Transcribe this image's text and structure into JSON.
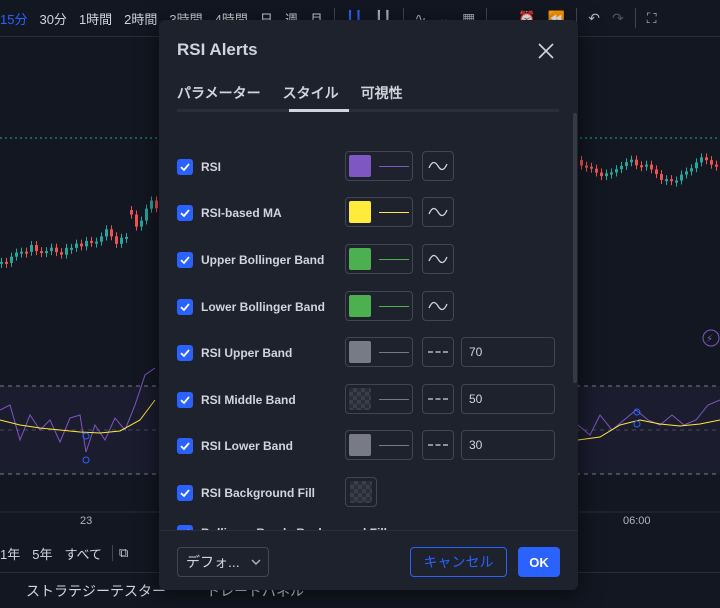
{
  "toolbar": {
    "timeframes": [
      "15分",
      "30分",
      "1時間",
      "2時間",
      "3時間",
      "4時間",
      "日",
      "週",
      "月"
    ],
    "active_timeframe": "15分"
  },
  "chart": {
    "x_labels": [
      "23",
      "06:00"
    ]
  },
  "range_bar": [
    "1年",
    "5年",
    "すべて"
  ],
  "bottom_tabs": [
    "ストラテジーテスター",
    "トレードパネル"
  ],
  "dialog": {
    "title": "RSI Alerts",
    "tabs": [
      "パラメーター",
      "スタイル",
      "可視性"
    ],
    "active_tab": "スタイル",
    "rows": [
      {
        "label": "RSI",
        "checked": true,
        "color": "#7e57c2",
        "line_color": "#7e57c2",
        "line_style": "wave",
        "value": ""
      },
      {
        "label": "RSI-based MA",
        "checked": true,
        "color": "#ffeb3b",
        "line_color": "#ffeb3b",
        "line_style": "wave",
        "value": ""
      },
      {
        "label": "Upper Bollinger Band",
        "checked": true,
        "color": "#4caf50",
        "line_color": "#4caf50",
        "line_style": "wave",
        "value": ""
      },
      {
        "label": "Lower Bollinger Band",
        "checked": true,
        "color": "#4caf50",
        "line_color": "#4caf50",
        "line_style": "wave",
        "value": ""
      },
      {
        "label": "RSI Upper Band",
        "checked": true,
        "color": "#787b86",
        "line_color": "#787b86",
        "line_style": "dash",
        "value": "70"
      },
      {
        "label": "RSI Middle Band",
        "checked": true,
        "color": "checker",
        "line_color": "#787b86",
        "line_style": "dash",
        "value": "50"
      },
      {
        "label": "RSI Lower Band",
        "checked": true,
        "color": "#787b86",
        "line_color": "#787b86",
        "line_style": "dash",
        "value": "30"
      },
      {
        "label": "RSI Background Fill",
        "checked": true,
        "color": "checker",
        "line_color": "",
        "line_style": "none",
        "value": ""
      },
      {
        "label": "Bollinger Bands Background Fill",
        "checked": true,
        "color": "",
        "line_color": "",
        "line_style": "none",
        "value": ""
      }
    ],
    "defaults_label": "デフォ...",
    "cancel_label": "キャンセル",
    "ok_label": "OK"
  },
  "colors": {
    "accent": "#2962ff",
    "dialog_bg": "#1e222d",
    "chart_bg": "#131722",
    "candle_up": "#26a69a",
    "candle_down": "#ef5350"
  }
}
